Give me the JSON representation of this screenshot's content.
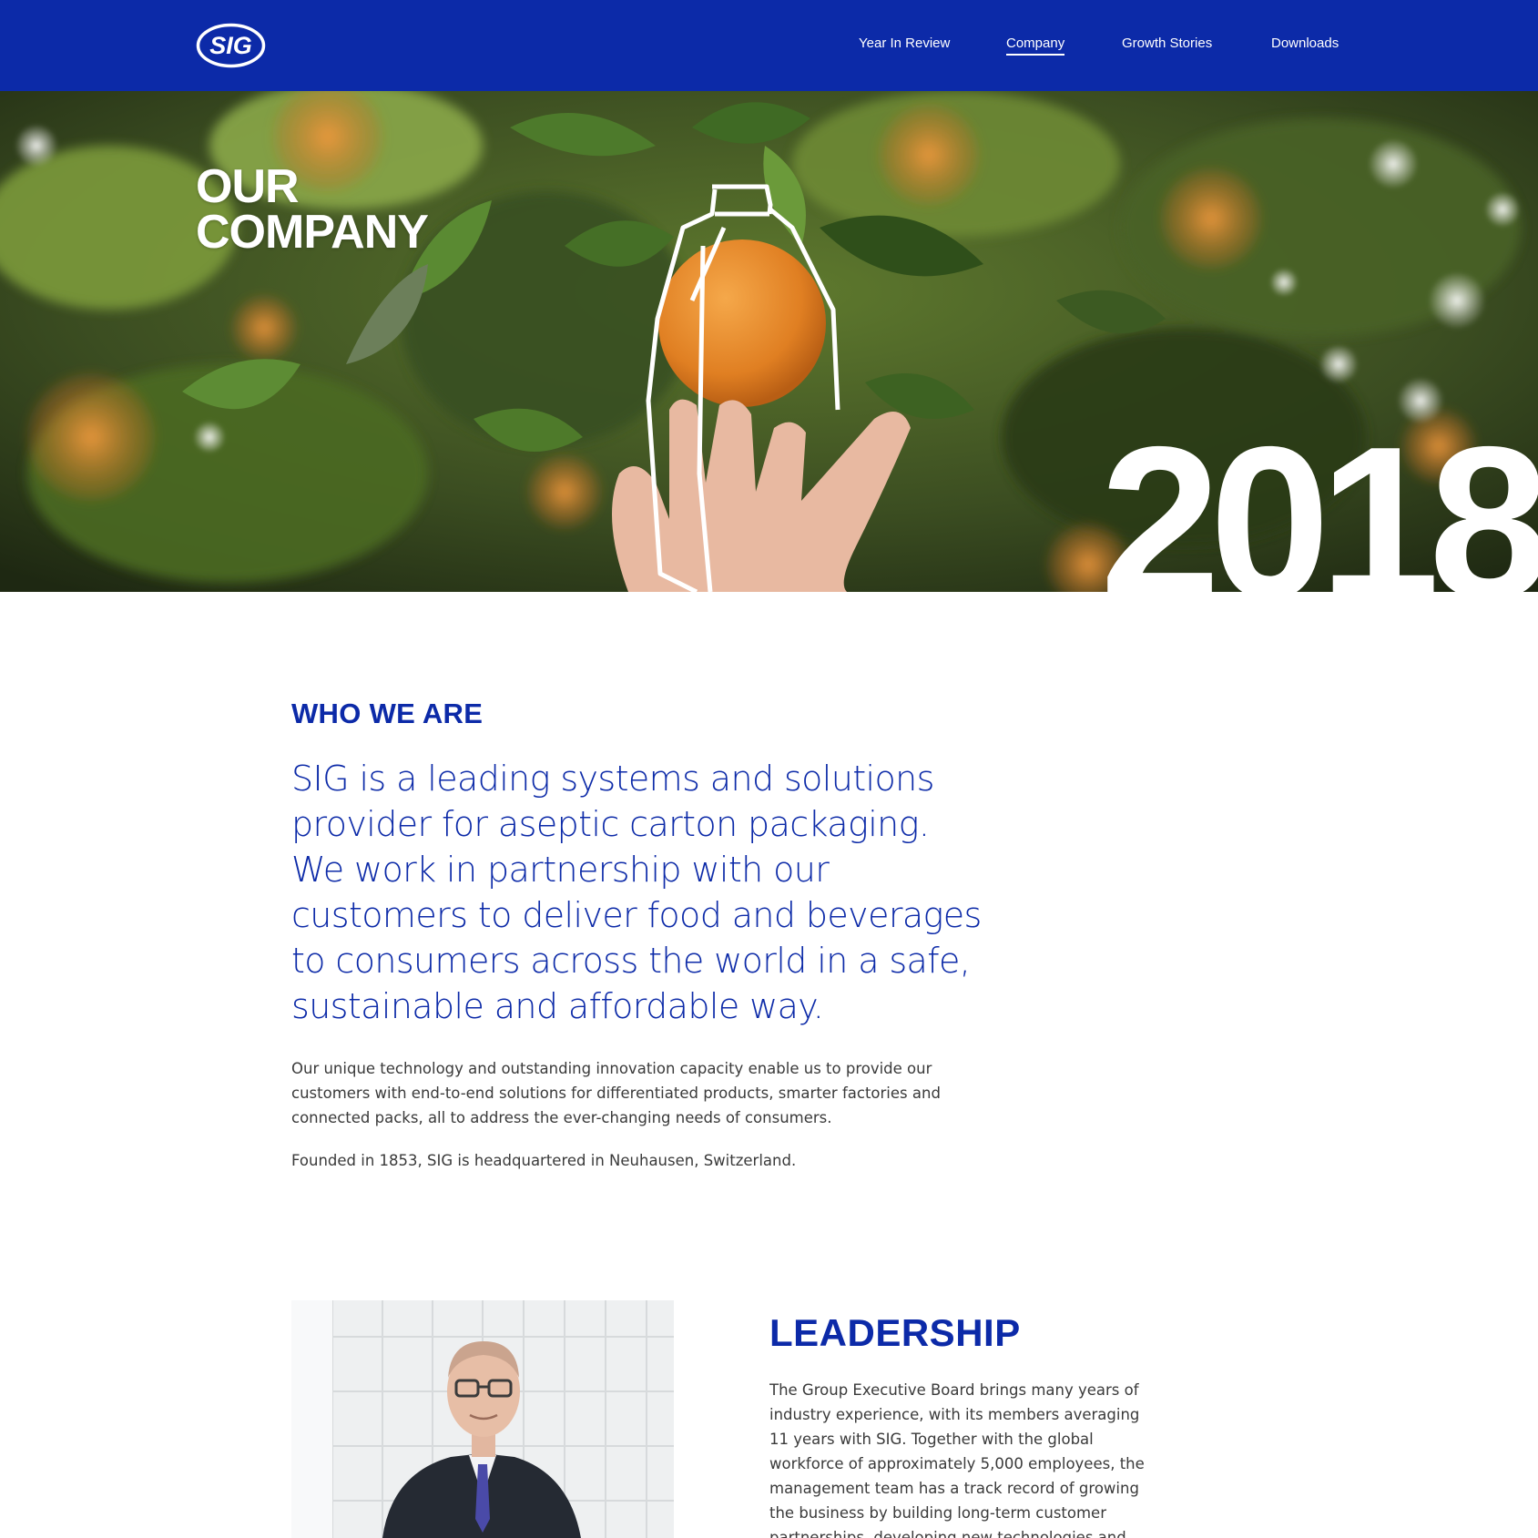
{
  "nav": {
    "logo_text": "SIG",
    "items": [
      {
        "label": "Year In Review",
        "active": false
      },
      {
        "label": "Company",
        "active": true
      },
      {
        "label": "Growth Stories",
        "active": false
      },
      {
        "label": "Downloads",
        "active": false
      }
    ]
  },
  "hero": {
    "title_line1": "OUR",
    "title_line2": "COMPANY",
    "year": "2018"
  },
  "who_we_are": {
    "heading": "WHO WE ARE",
    "lead": "SIG is a leading systems and solutions provider for aseptic carton packaging. We work in partnership with our customers to deliver food and beverages to consumers across the world in a safe, sustainable and affordable way.",
    "paragraph1": "Our unique technology and outstanding innovation capacity enable us to provide our customers with end-to-end solutions for differentiated products, smarter factories and connected packs, all to address the ever-changing needs of consumers.",
    "paragraph2": "Founded in 1853, SIG is headquartered in Neuhausen, Switzerland."
  },
  "leadership": {
    "heading": "LEADERSHIP",
    "text": "The Group Executive Board brings many years of industry experience, with its members averaging 11 years with SIG. Together with the global workforce of approximately 5,000 employees, the management team has a track record of growing the business by building long-term customer partnerships, developing new technologies and expanding into"
  },
  "colors": {
    "brand_blue": "#0c2aa8",
    "body_text": "#3a3a3a",
    "orange": "#e8892d"
  }
}
